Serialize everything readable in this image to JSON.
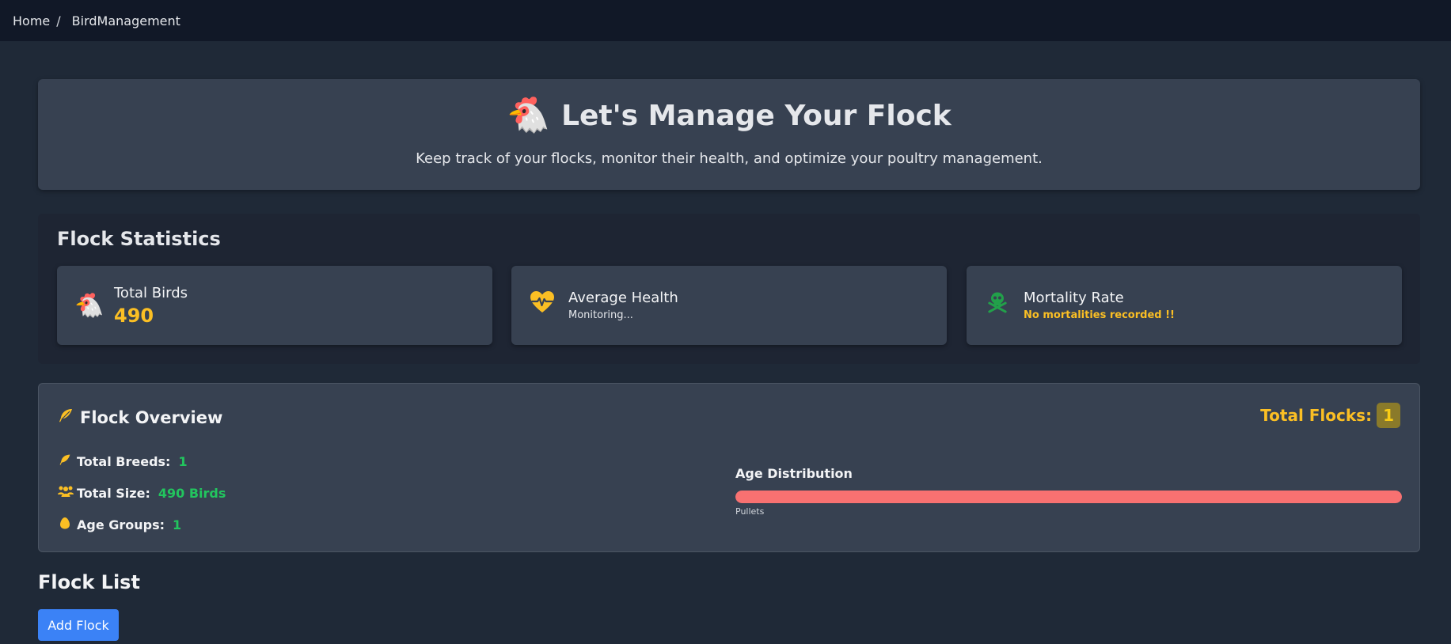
{
  "breadcrumb": {
    "home": "Home",
    "separator": "/",
    "current": "BirdManagement"
  },
  "hero": {
    "icon": "🐔",
    "title": "Let's Manage Your Flock",
    "subtitle": "Keep track of your flocks, monitor their health, and optimize your poultry management."
  },
  "stats": {
    "heading": "Flock Statistics",
    "cards": [
      {
        "icon": "chicken-icon",
        "glyph": "🐔",
        "label": "Total Birds",
        "value": "490"
      },
      {
        "icon": "heartbeat-icon",
        "label": "Average Health",
        "value": "Monitoring..."
      },
      {
        "icon": "skull-crossbones-icon",
        "label": "Mortality Rate",
        "value": "No mortalities recorded !!"
      }
    ]
  },
  "overview": {
    "title": "Flock Overview",
    "total_flocks_label": "Total Flocks:",
    "total_flocks_value": "1",
    "rows": [
      {
        "icon": "feather-icon",
        "label": "Total Breeds:",
        "value": "1"
      },
      {
        "icon": "users-icon",
        "label": "Total Size:",
        "value": "490 Birds"
      },
      {
        "icon": "egg-icon",
        "label": "Age Groups:",
        "value": "1"
      }
    ],
    "age_distribution": {
      "title": "Age Distribution",
      "segments": [
        {
          "label": "Pullets",
          "fraction": 1.0,
          "color": "#f87171"
        }
      ]
    }
  },
  "flock_list": {
    "title": "Flock List",
    "add_button": "Add Flock"
  },
  "colors": {
    "accent": "#3b82f6",
    "warning": "#fbbf24",
    "success": "#22c55e",
    "danger": "#f87171",
    "skull": "#22a04a"
  }
}
